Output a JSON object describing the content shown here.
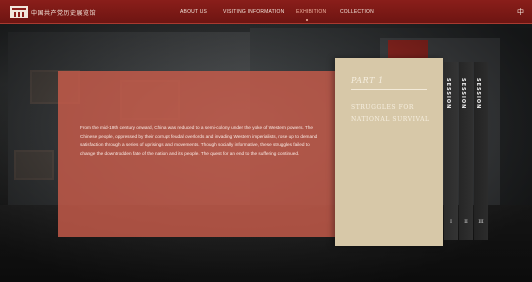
{
  "header": {
    "logo_text": "中国共产党历史展览馆",
    "nav": [
      {
        "label": "ABOUT US",
        "active": false
      },
      {
        "label": "VISITING INFORMATION",
        "active": false
      },
      {
        "label": "EXHIBITION",
        "active": true
      },
      {
        "label": "COLLECTION",
        "active": false
      }
    ],
    "lang_switch": "中"
  },
  "panel": {
    "text": "From the mid-19th century onward, China was reduced to a semi-colony under the yoke of Western powers. The Chinese people, oppressed by their corrupt feudal overlords and invading Western imperialists, rose up to demand satisfaction through a series of uprisings and movements. Though socially informative, these struggles failed to change the downtrodden fate of the nation and its people. The quest for an end to the suffering continued."
  },
  "card": {
    "part": "PART 1",
    "title": "STRUGGLES FOR NATIONAL SURVIVAL"
  },
  "sessions": [
    {
      "label": "SESSION",
      "number": "I"
    },
    {
      "label": "SESSION",
      "number": "II"
    },
    {
      "label": "SESSION",
      "number": "III"
    }
  ],
  "colors": {
    "topbar": "#8a1e1a",
    "panel": "#c85c4a",
    "card": "#d7c8a8"
  }
}
